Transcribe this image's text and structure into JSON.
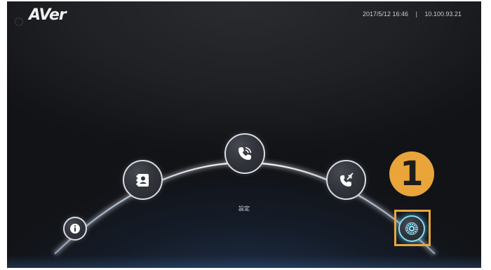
{
  "brand": {
    "logo_text": "AVer"
  },
  "status_bar": {
    "datetime": "2017/5/12 16:46",
    "separator": "|",
    "ip_address": "10.100.93.21"
  },
  "menu": {
    "selected_label": "設定",
    "items": [
      {
        "icon": "info-icon",
        "selected": false
      },
      {
        "icon": "contacts-icon",
        "selected": false
      },
      {
        "icon": "call-icon",
        "selected": false
      },
      {
        "icon": "call-history-icon",
        "selected": false
      },
      {
        "icon": "settings-gear-icon",
        "selected": true
      }
    ]
  },
  "annotation": {
    "step_number": "1"
  },
  "colors": {
    "background": "#1b1c20",
    "arc": "#ffffff",
    "highlight": "#e8a73b",
    "selected_glow": "#55c9f0"
  }
}
